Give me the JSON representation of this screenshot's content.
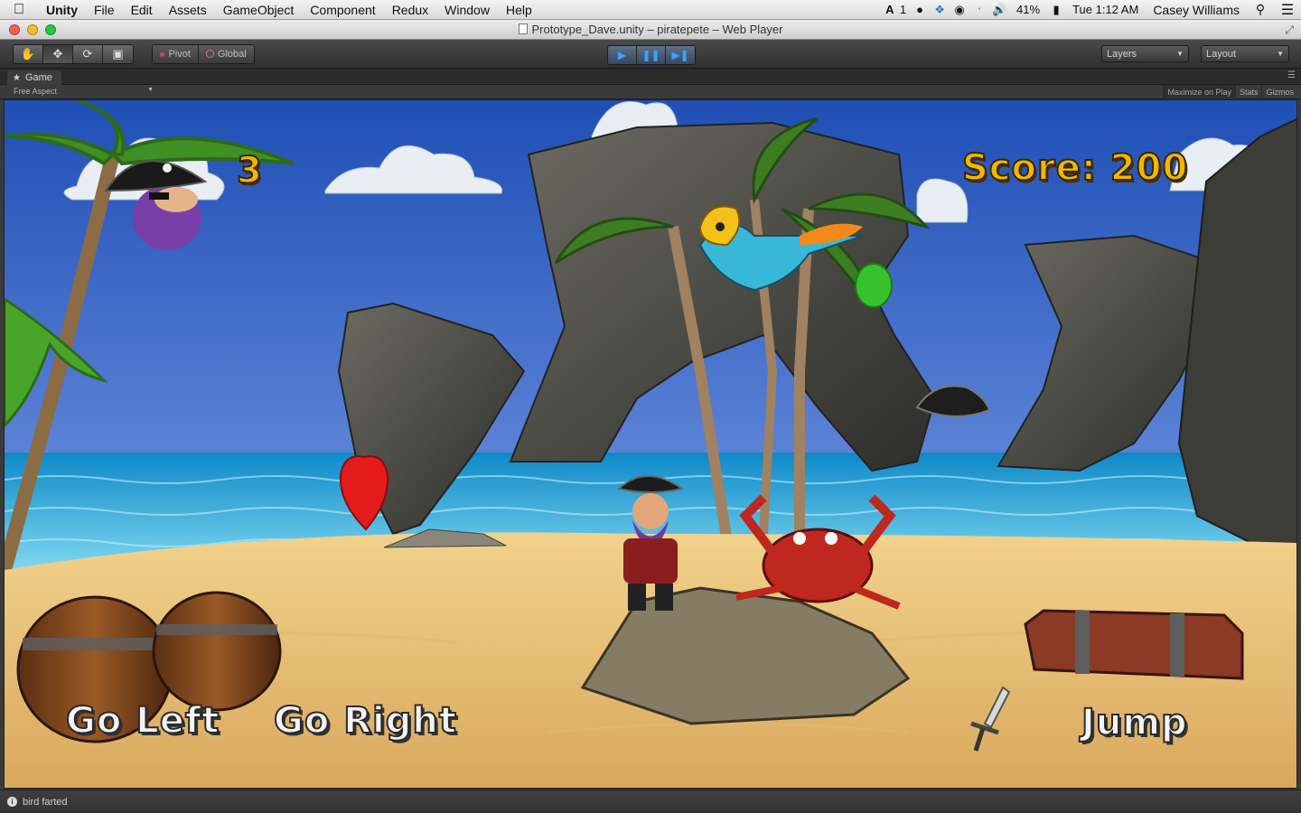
{
  "menubar": {
    "apple": "",
    "app": "Unity",
    "items": [
      "File",
      "Edit",
      "Assets",
      "GameObject",
      "Component",
      "Redux",
      "Window",
      "Help"
    ],
    "status": {
      "adobe": "1",
      "battery": "41%",
      "clock": "Tue 1:12 AM",
      "user": "Casey Williams"
    }
  },
  "window": {
    "title": "Prototype_Dave.unity – piratepete – Web Player"
  },
  "toolbar": {
    "pivot_label": "Pivot",
    "global_label": "Global",
    "layers_label": "Layers",
    "layout_label": "Layout"
  },
  "game_panel": {
    "tab_label": "Game",
    "aspect_label": "Free Aspect",
    "maximize_label": "Maximize on Play",
    "stats_label": "Stats",
    "gizmos_label": "Gizmos"
  },
  "hud": {
    "lives": "3",
    "score": "Score: 200",
    "go_left": "Go Left",
    "go_right": "Go Right",
    "jump": "Jump"
  },
  "status_bar": {
    "message": "bird farted"
  },
  "icons": {
    "hand": "hand-tool-icon",
    "move": "move-tool-icon",
    "rotate": "rotate-tool-icon",
    "scale": "scale-tool-icon",
    "play": "play-icon",
    "pause": "pause-icon",
    "step": "step-icon"
  },
  "colors": {
    "hud_gold": "#f0b800",
    "play_blue": "#3aa0ff"
  }
}
